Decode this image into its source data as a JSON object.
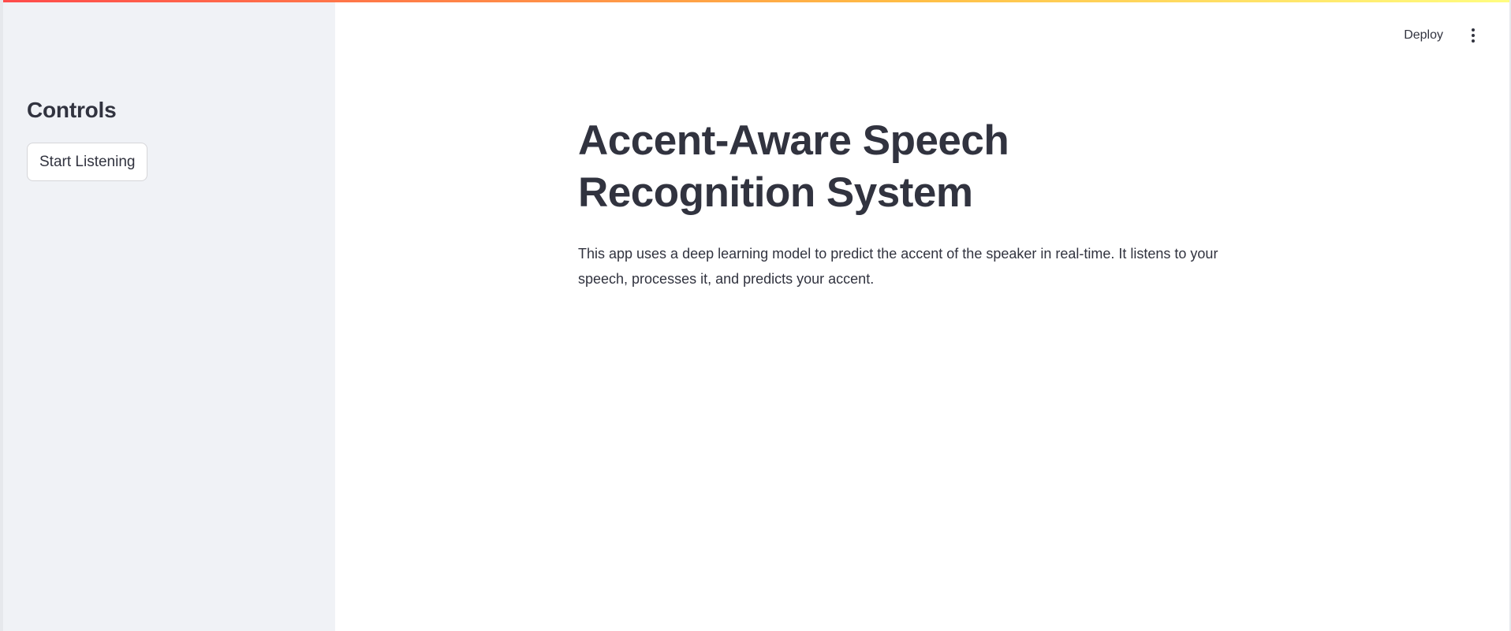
{
  "sidebar": {
    "heading": "Controls",
    "start_button_label": "Start Listening",
    "background_color": "#f0f2f6"
  },
  "header": {
    "deploy_label": "Deploy",
    "menu_icon": "vertical-ellipsis-icon"
  },
  "main": {
    "title": "Accent-Aware Speech Recognition System",
    "description": "This app uses a deep learning model to predict the accent of the speaker in real-time. It listens to your speech, processes it, and predicts your accent."
  },
  "colors": {
    "text": "#31333f",
    "decoration_gradient": [
      "#ff4b4b",
      "#ffbd45",
      "#fffd80"
    ]
  }
}
